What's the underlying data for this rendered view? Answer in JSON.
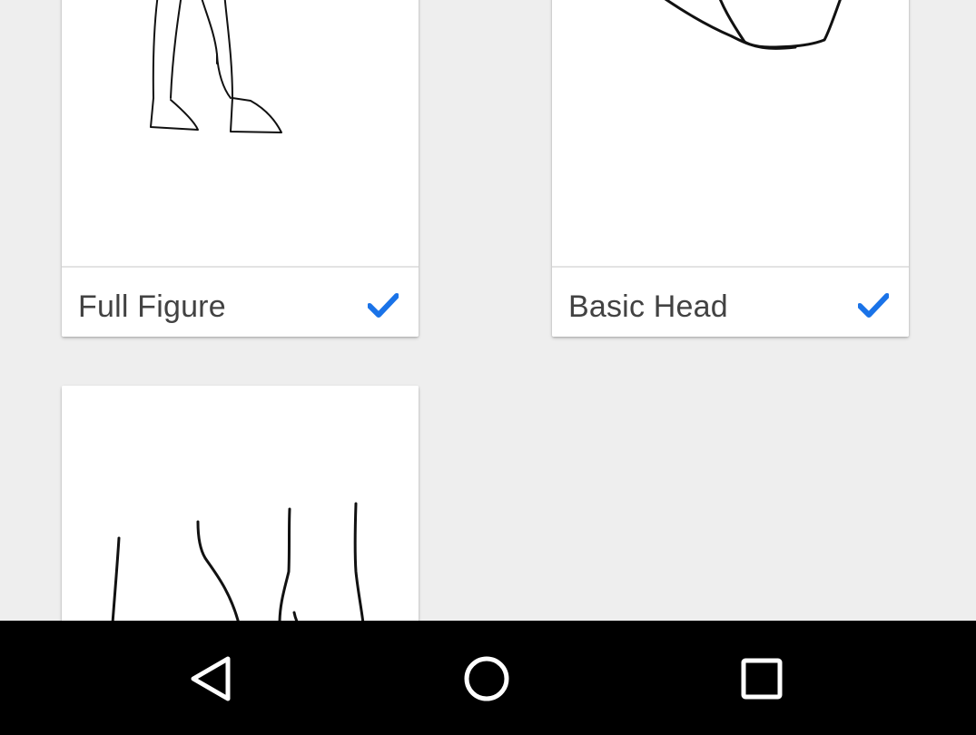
{
  "cards": [
    {
      "title": "Full Figure",
      "checked_icon": "checkmark-icon",
      "thumbnail": "full-figure-sketch"
    },
    {
      "title": "Basic Head",
      "checked_icon": "checkmark-icon",
      "thumbnail": "basic-head-sketch"
    },
    {
      "title": "",
      "thumbnail": "legs-sketch"
    }
  ],
  "navbar": {
    "back_icon": "back-icon",
    "home_icon": "home-icon",
    "recents_icon": "recents-icon"
  },
  "colors": {
    "background": "#eeeeee",
    "card": "#ffffff",
    "check": "#1a73e8",
    "text": "#424242",
    "navbar": "#000000"
  }
}
